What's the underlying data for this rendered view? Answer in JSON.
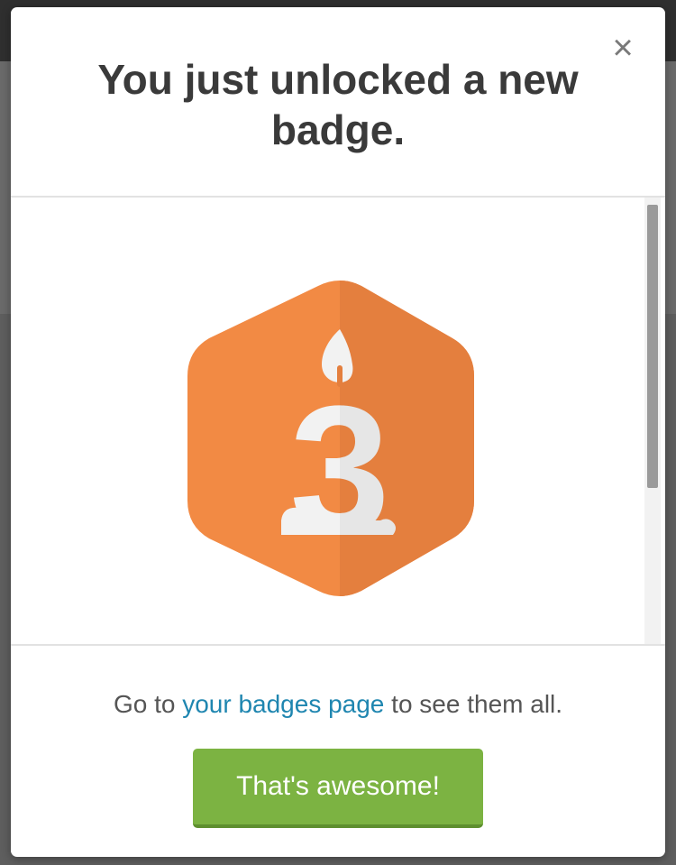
{
  "modal": {
    "title": "You just unlocked a new badge.",
    "close_glyph": "×",
    "close_icon": "close-icon"
  },
  "badge": {
    "number": "3",
    "icon": "birthday-candle-icon",
    "colors": {
      "orange": "#f28a44",
      "orange_shade": "#e47f3e",
      "candle": "#f2f2f2",
      "candle_shade": "#e6e6e6"
    }
  },
  "footer": {
    "message_prefix": "Go to ",
    "link_text": "your badges page",
    "message_suffix": " to see them all.",
    "button_label": "That's awesome!"
  },
  "colors": {
    "accent_green": "#7cb342",
    "link_blue": "#1f86b0",
    "title_text": "#3a3a3a"
  }
}
